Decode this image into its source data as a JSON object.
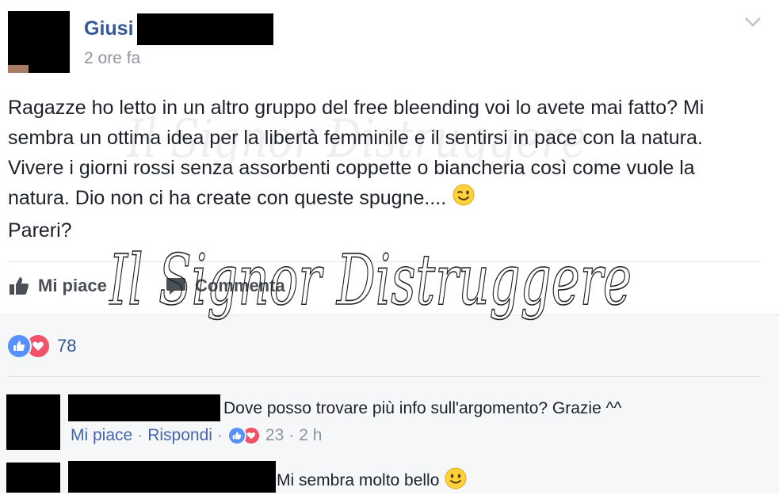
{
  "post": {
    "author_name": "Giusi",
    "timestamp": "2 ore fa",
    "text": "Ragazze ho letto in un altro gruppo del free bleending voi lo avete mai fatto? Mi sembra un ottima idea per la libertà femminile e il sentirsi in pace con la natura. Vivere i giorni rossi senza assorbenti coppette o biancheria così come vuole la natura. Dio non ci ha create con queste spugne....",
    "text_tail": "Pareri?",
    "emoji": "wink-emoji"
  },
  "actions": {
    "like_label": "Mi piace",
    "comment_label": "Commenta"
  },
  "reactions": {
    "count": "78",
    "types": [
      "like",
      "love"
    ]
  },
  "comments": [
    {
      "text": "Dove posso trovare più info sull'argomento? Grazie ^^",
      "like_label": "Mi piace",
      "reply_label": "Rispondi",
      "separator": "·",
      "reaction_count": "23",
      "time": "2 h"
    },
    {
      "text": "Mi sembra molto bello",
      "emoji": "smile-emoji"
    }
  ],
  "watermark": {
    "text": "Il Signor Distruggere"
  },
  "colors": {
    "link_blue": "#365899",
    "meta_grey": "#90949c",
    "like_blue": "#5890ff",
    "love_red": "#f25268",
    "comments_bg": "#f6f7f9"
  },
  "icons": [
    "chevron-down-icon",
    "thumbs-up-icon",
    "comment-icon",
    "like-reaction-icon",
    "love-reaction-icon"
  ]
}
